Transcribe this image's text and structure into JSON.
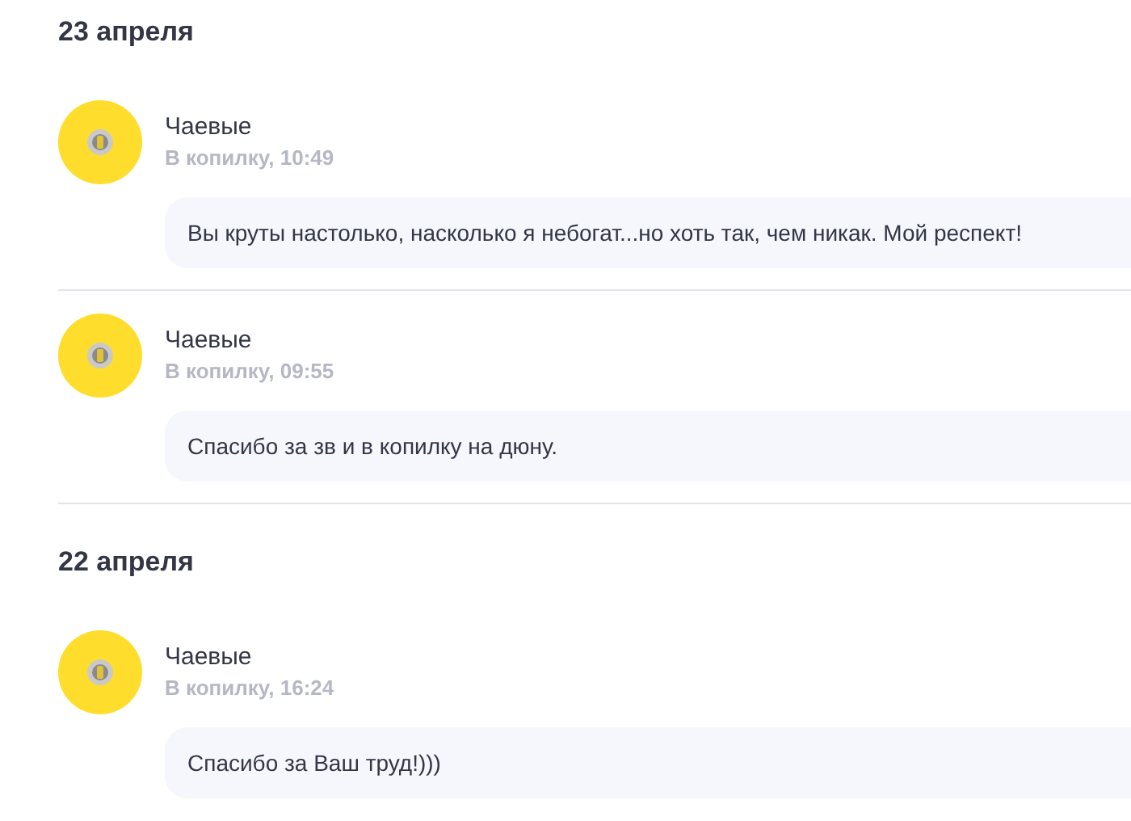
{
  "days": [
    {
      "date": "23 апреля",
      "messages": [
        {
          "author": "Чаевые",
          "meta": "В копилку, 10:49",
          "text": "Вы круты настолько, насколько я небогат...но хоть так, чем никак. Мой респект!"
        },
        {
          "author": "Чаевые",
          "meta": "В копилку, 09:55",
          "text": "Спасибо за зв и в копилку на дюну."
        }
      ]
    },
    {
      "date": "22 апреля",
      "messages": [
        {
          "author": "Чаевые",
          "meta": "В копилку, 16:24",
          "text": "Спасибо за Ваш труд!)))"
        }
      ]
    }
  ]
}
